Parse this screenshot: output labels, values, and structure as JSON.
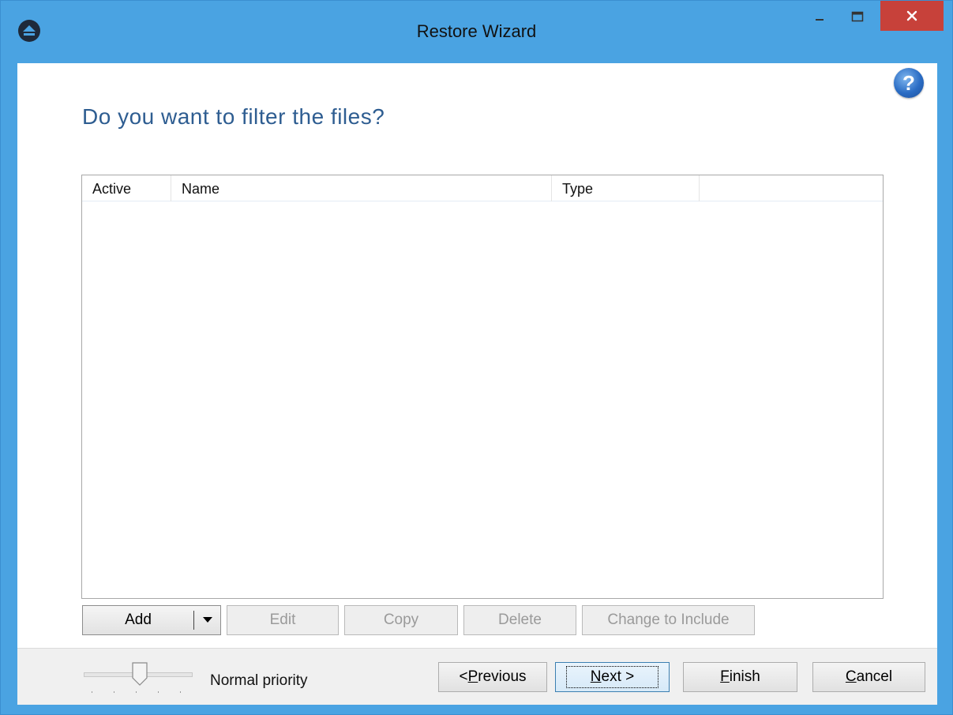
{
  "window": {
    "title": "Restore Wizard",
    "colors": {
      "titlebar": "#4aa3e2",
      "close": "#c7413a",
      "heading": "#2e5d91"
    }
  },
  "page": {
    "heading": "Do you want to filter the files?"
  },
  "filter_list": {
    "columns": [
      "Active",
      "Name",
      "Type"
    ],
    "rows": []
  },
  "toolbar": {
    "add_label": "Add",
    "edit_label": "Edit",
    "copy_label": "Copy",
    "delete_label": "Delete",
    "change_label": "Change to Include"
  },
  "footer": {
    "priority_label": "Normal priority",
    "previous_prefix": "< ",
    "previous_mnemonic": "P",
    "previous_rest": "revious",
    "next_mnemonic": "N",
    "next_rest": "ext >",
    "finish_mnemonic": "F",
    "finish_rest": "inish",
    "cancel_mnemonic": "C",
    "cancel_rest": "ancel"
  },
  "icons": [
    "app-icon",
    "minimize-icon",
    "maximize-icon",
    "close-icon",
    "help-icon",
    "dropdown-arrow-icon"
  ]
}
